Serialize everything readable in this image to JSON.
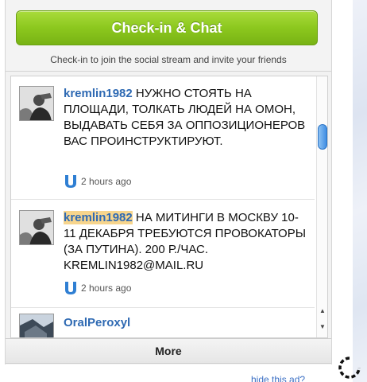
{
  "checkin": {
    "button_label": "Check-in & Chat",
    "hint": "Check-in to join the social stream and invite your friends"
  },
  "posts": [
    {
      "username": "kremlin1982",
      "text": " НУЖНО СТОЯТЬ НА ПЛОЩАДИ, ТОЛКАТЬ ЛЮДЕЙ НА ОМОН, ВЫДАВАТЬ СЕБЯ ЗА ОППОЗИЦИОНЕРОВ ВАС ПРОИНСТРУКТИРУЮТ.",
      "time": "2 hours ago",
      "source_icon": "u-source-icon"
    },
    {
      "username": "kremlin1982",
      "text": " НА МИТИНГИ В МОСКВУ 10-11 ДЕКАБРЯ ТРЕБУЮТСЯ ПРОВОКАТОРЫ (ЗА ПУТИНА). 200 Р./ЧАС. KREMLIN1982@MAIL.RU",
      "time": "2 hours ago",
      "source_icon": "u-source-icon"
    },
    {
      "username": "OralPeroxyl"
    }
  ],
  "more_label": "More",
  "hide_ad_label": "hide this ad?",
  "colors": {
    "checkin_green": "#8cc81e",
    "username_blue": "#2f6ab3",
    "highlight": "#f7d58d",
    "link_blue": "#3b6fc4"
  }
}
